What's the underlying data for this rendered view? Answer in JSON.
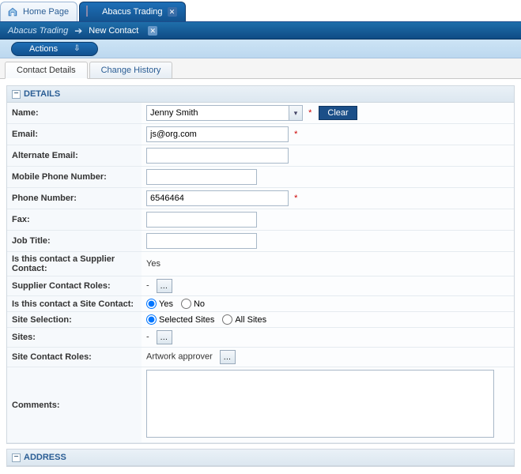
{
  "topTabs": {
    "home": "Home Page",
    "active": "Abacus Trading"
  },
  "breadcrumb": {
    "root": "Abacus Trading",
    "current": "New Contact"
  },
  "actions": {
    "label": "Actions"
  },
  "subTabs": {
    "contactDetails": "Contact Details",
    "changeHistory": "Change History"
  },
  "sections": {
    "details": "DETAILS",
    "address": "ADDRESS"
  },
  "form": {
    "labels": {
      "name": "Name:",
      "email": "Email:",
      "altEmail": "Alternate Email:",
      "mobile": "Mobile Phone Number:",
      "phone": "Phone Number:",
      "fax": "Fax:",
      "jobTitle": "Job Title:",
      "isSupplierContact": "Is this contact a Supplier Contact:",
      "supplierRoles": "Supplier Contact Roles:",
      "isSiteContact": "Is this contact a Site Contact:",
      "siteSelection": "Site Selection:",
      "sites": "Sites:",
      "siteContactRoles": "Site Contact Roles:",
      "comments": "Comments:"
    },
    "values": {
      "name": "Jenny Smith",
      "email": "js@org.com",
      "altEmail": "",
      "mobile": "",
      "phone": "6546464",
      "fax": "",
      "jobTitle": "",
      "isSupplierContact": "Yes",
      "supplierRoles": "-",
      "sites": "-",
      "siteContactRoles": "Artwork approver",
      "comments": ""
    },
    "radios": {
      "yes": "Yes",
      "no": "No",
      "selectedSites": "Selected Sites",
      "allSites": "All Sites"
    },
    "buttons": {
      "clear": "Clear"
    }
  }
}
